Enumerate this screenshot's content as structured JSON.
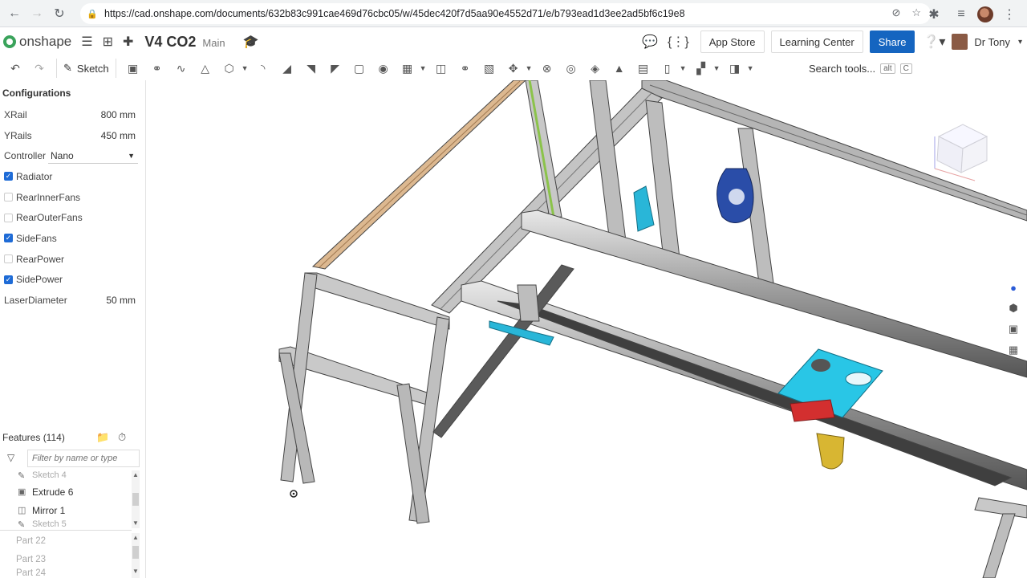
{
  "browser": {
    "url": "https://cad.onshape.com/documents/632b83c991cae469d76cbc05/w/45dec420f7d5aa90e4552d71/e/b793ead1d3ee2ad5bf6c19e8",
    "back_icon": "arrow-left-icon",
    "forward_icon": "arrow-right-icon",
    "reload_icon": "reload-icon"
  },
  "header": {
    "brand": "onshape",
    "doc_title": "V4 CO2",
    "branch": "Main",
    "app_store": "App Store",
    "learning_center": "Learning Center",
    "share": "Share",
    "user": "Dr Tony",
    "accent": "#1565c0"
  },
  "toolbar": {
    "sketch_label": "Sketch",
    "search_label": "Search tools...",
    "shortcut_1": "alt",
    "shortcut_2": "C"
  },
  "configurations": {
    "title": "Configurations",
    "xrail_label": "XRail",
    "xrail_value": "800 mm",
    "yrails_label": "YRails",
    "yrails_value": "450 mm",
    "controller_label": "Controller",
    "controller_value": "Nano",
    "options": [
      {
        "label": "Radiator",
        "checked": true
      },
      {
        "label": "RearInnerFans",
        "checked": false
      },
      {
        "label": "RearOuterFans",
        "checked": false
      },
      {
        "label": "SideFans",
        "checked": true
      },
      {
        "label": "RearPower",
        "checked": false
      },
      {
        "label": "SidePower",
        "checked": true
      }
    ],
    "laser_label": "LaserDiameter",
    "laser_value": "50 mm"
  },
  "features": {
    "title": "Features (114)",
    "filter_placeholder": "Filter by name or type",
    "items": [
      "Sketch 4",
      "Extrude 6",
      "Mirror 1",
      "Sketch 5"
    ],
    "parts": [
      "Part 22",
      "Part 23",
      "Part 24"
    ]
  }
}
